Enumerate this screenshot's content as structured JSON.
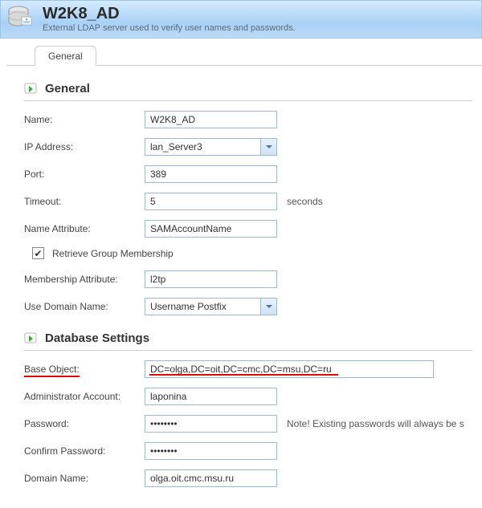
{
  "header": {
    "title": "W2K8_AD",
    "subtitle": "External LDAP server used to verify user names and passwords."
  },
  "tabs": {
    "general": "General"
  },
  "sections": {
    "general": "General",
    "db": "Database Settings"
  },
  "general": {
    "name_label": "Name:",
    "name_value": "W2K8_AD",
    "ip_label": "IP Address:",
    "ip_value": "lan_Server3",
    "port_label": "Port:",
    "port_value": "389",
    "timeout_label": "Timeout:",
    "timeout_value": "5",
    "timeout_unit": "seconds",
    "nameattr_label": "Name Attribute:",
    "nameattr_value": "SAMAccountName",
    "retrieve_label": "Retrieve Group Membership",
    "retrieve_checked": "✓",
    "membership_label": "Membership Attribute:",
    "membership_value": "l2tp",
    "usedomain_label": "Use Domain Name:",
    "usedomain_value": "Username Postfix"
  },
  "db": {
    "baseobj_label": "Base Object:",
    "baseobj_value": "DC=olga,DC=oit,DC=cmc,DC=msu,DC=ru",
    "admin_label": "Administrator Account:",
    "admin_value": "laponina",
    "pass_label": "Password:",
    "pass_value": "••••••••",
    "pass_note": "Note! Existing passwords will always be s",
    "confirm_label": "Confirm Password:",
    "confirm_value": "••••••••",
    "domain_label": "Domain Name:",
    "domain_value": "olga.oit.cmc.msu.ru"
  }
}
